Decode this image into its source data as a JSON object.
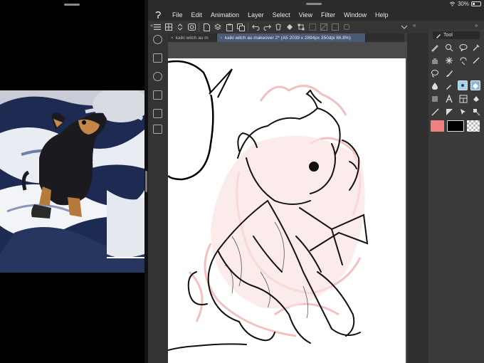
{
  "status": {
    "battery_text": "30%",
    "battery_level": 0.3
  },
  "menu": [
    {
      "label": "File"
    },
    {
      "label": "Edit"
    },
    {
      "label": "Animation"
    },
    {
      "label": "Layer"
    },
    {
      "label": "Select"
    },
    {
      "label": "View"
    },
    {
      "label": "Filter"
    },
    {
      "label": "Window"
    },
    {
      "label": "Help"
    }
  ],
  "tabs": [
    {
      "label": "kaiki witch au m"
    },
    {
      "label": "kaiki witch au makeover 2* (A5 2039 x 2894px 350dpi 86.8%)"
    }
  ],
  "palette": {
    "tab_label": "Tool"
  },
  "colors": {
    "main_color": "#f08080",
    "sub_color": "#000000",
    "transparent": "checker"
  }
}
